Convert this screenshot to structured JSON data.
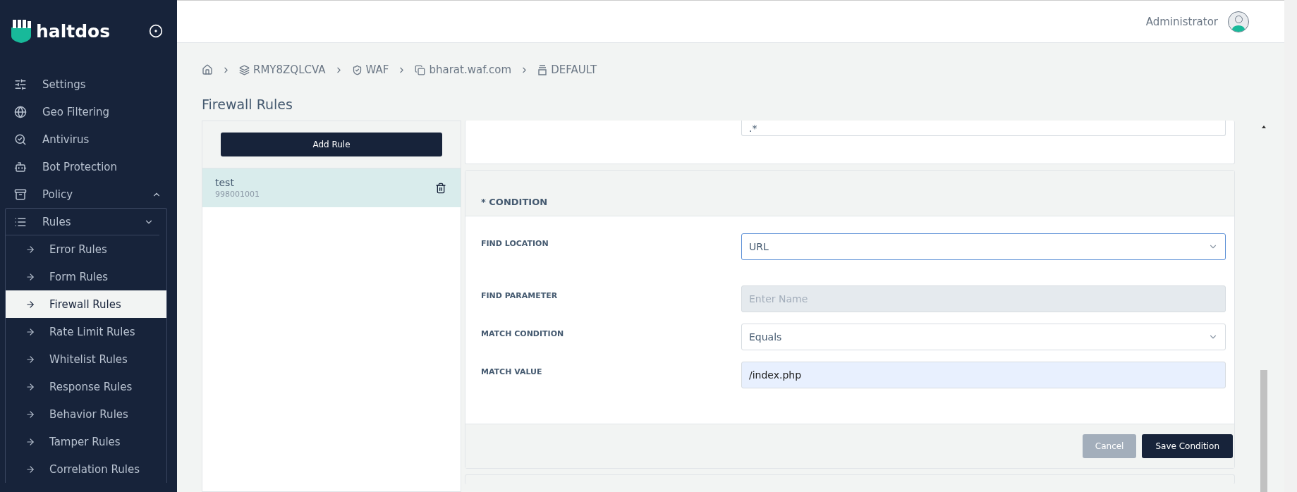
{
  "sidebar": {
    "brand": "haltdos",
    "items": [
      {
        "label": "Settings",
        "kind": "top"
      },
      {
        "label": "Geo Filtering",
        "kind": "top"
      },
      {
        "label": "Antivirus",
        "kind": "top"
      },
      {
        "label": "Bot Protection",
        "kind": "top"
      },
      {
        "label": "Policy",
        "kind": "top",
        "expanded": true
      },
      {
        "label": "Rules",
        "kind": "group",
        "expanded": true,
        "children": [
          {
            "label": "Error Rules",
            "selected": false
          },
          {
            "label": "Form Rules",
            "selected": false
          },
          {
            "label": "Firewall Rules",
            "selected": true
          },
          {
            "label": "Rate Limit Rules",
            "selected": false
          },
          {
            "label": "Whitelist Rules",
            "selected": false
          },
          {
            "label": "Response Rules",
            "selected": false
          },
          {
            "label": "Behavior Rules",
            "selected": false
          },
          {
            "label": "Tamper Rules",
            "selected": false
          },
          {
            "label": "Correlation Rules",
            "selected": false
          }
        ]
      }
    ]
  },
  "header": {
    "user": "Administrator"
  },
  "breadcrumb": [
    {
      "label": "RMY8ZQLCVA"
    },
    {
      "label": "WAF"
    },
    {
      "label": "bharat.waf.com"
    },
    {
      "label": "DEFAULT"
    }
  ],
  "page_title": "Firewall Rules",
  "rules_panel": {
    "add_button": "Add Rule",
    "rules": [
      {
        "name": "test",
        "id": "998001001",
        "selected": true
      }
    ]
  },
  "pattern_field": {
    "value": ".*"
  },
  "condition": {
    "title": "* CONDITION",
    "fields": [
      {
        "label": "FIND LOCATION",
        "kind": "select",
        "value": "URL",
        "focused": true
      },
      {
        "label": "FIND PARAMETER",
        "kind": "input",
        "placeholder": "Enter Name",
        "disabled": true
      },
      {
        "label": "MATCH CONDITION",
        "kind": "select",
        "value": "Equals",
        "focused": false
      },
      {
        "label": "MATCH VALUE",
        "kind": "input",
        "value": "/index.php",
        "autofilled": true
      }
    ],
    "buttons": [
      {
        "label": "Cancel",
        "kind": "secondary"
      },
      {
        "label": "Save Condition",
        "kind": "primary"
      }
    ]
  }
}
